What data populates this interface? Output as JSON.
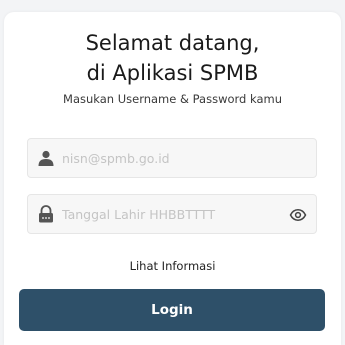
{
  "header": {
    "title_line1": "Selamat datang,",
    "title_line2": "di Aplikasi SPMB",
    "subtitle": "Masukan Username & Password kamu"
  },
  "form": {
    "username": {
      "placeholder": "nisn@spmb.go.id",
      "value": "",
      "icon": "user-icon"
    },
    "password": {
      "placeholder": "Tanggal Lahir HHBBTTTT",
      "value": "",
      "icon": "lock-icon",
      "toggle_icon": "eye-icon"
    },
    "info_link": "Lihat Informasi",
    "login_label": "Login"
  },
  "colors": {
    "primary": "#2e5069",
    "field_bg": "#f7f7f7",
    "placeholder": "#c4c4c4"
  }
}
